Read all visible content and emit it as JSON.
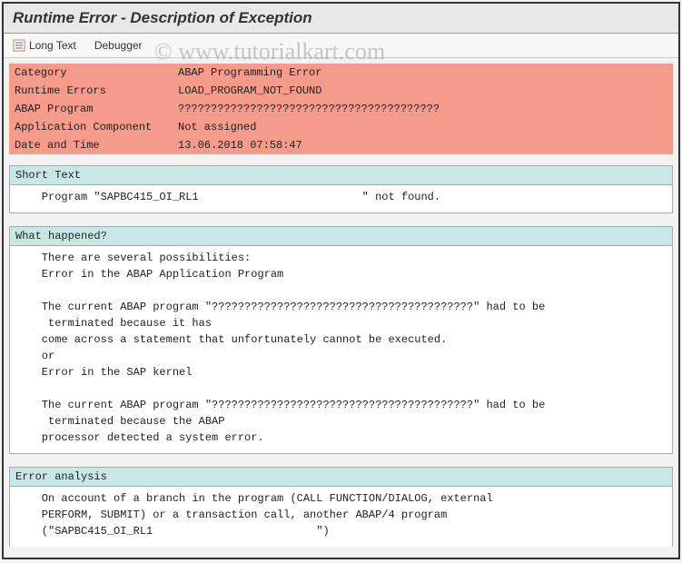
{
  "title": "Runtime Error - Description of Exception",
  "toolbar": {
    "long_text": "Long Text",
    "debugger": "Debugger"
  },
  "watermark": "© www.tutorialkart.com",
  "info": {
    "rows": [
      {
        "label": "Category",
        "value": "ABAP Programming Error"
      },
      {
        "label": "Runtime Errors",
        "value": "LOAD_PROGRAM_NOT_FOUND"
      },
      {
        "label": "ABAP Program",
        "value": "????????????????????????????????????????"
      },
      {
        "label": "Application Component",
        "value": "Not assigned"
      },
      {
        "label": "Date and Time",
        "value": "13.06.2018 07:58:47"
      }
    ]
  },
  "sections": {
    "short_text": {
      "header": "Short Text",
      "body": "    Program \"SAPBC415_OI_RL1                         \" not found."
    },
    "what_happened": {
      "header": "What happened?",
      "body": "    There are several possibilities:\n    Error in the ABAP Application Program\n\n    The current ABAP program \"????????????????????????????????????????\" had to be\n     terminated because it has\n    come across a statement that unfortunately cannot be executed.\n    or\n    Error in the SAP kernel\n\n    The current ABAP program \"????????????????????????????????????????\" had to be\n     terminated because the ABAP\n    processor detected a system error."
    },
    "error_analysis": {
      "header": "Error analysis",
      "body": "    On account of a branch in the program (CALL FUNCTION/DIALOG, external\n    PERFORM, SUBMIT) or a transaction call, another ABAP/4 program\n    (\"SAPBC415_OI_RL1                         \")"
    }
  }
}
